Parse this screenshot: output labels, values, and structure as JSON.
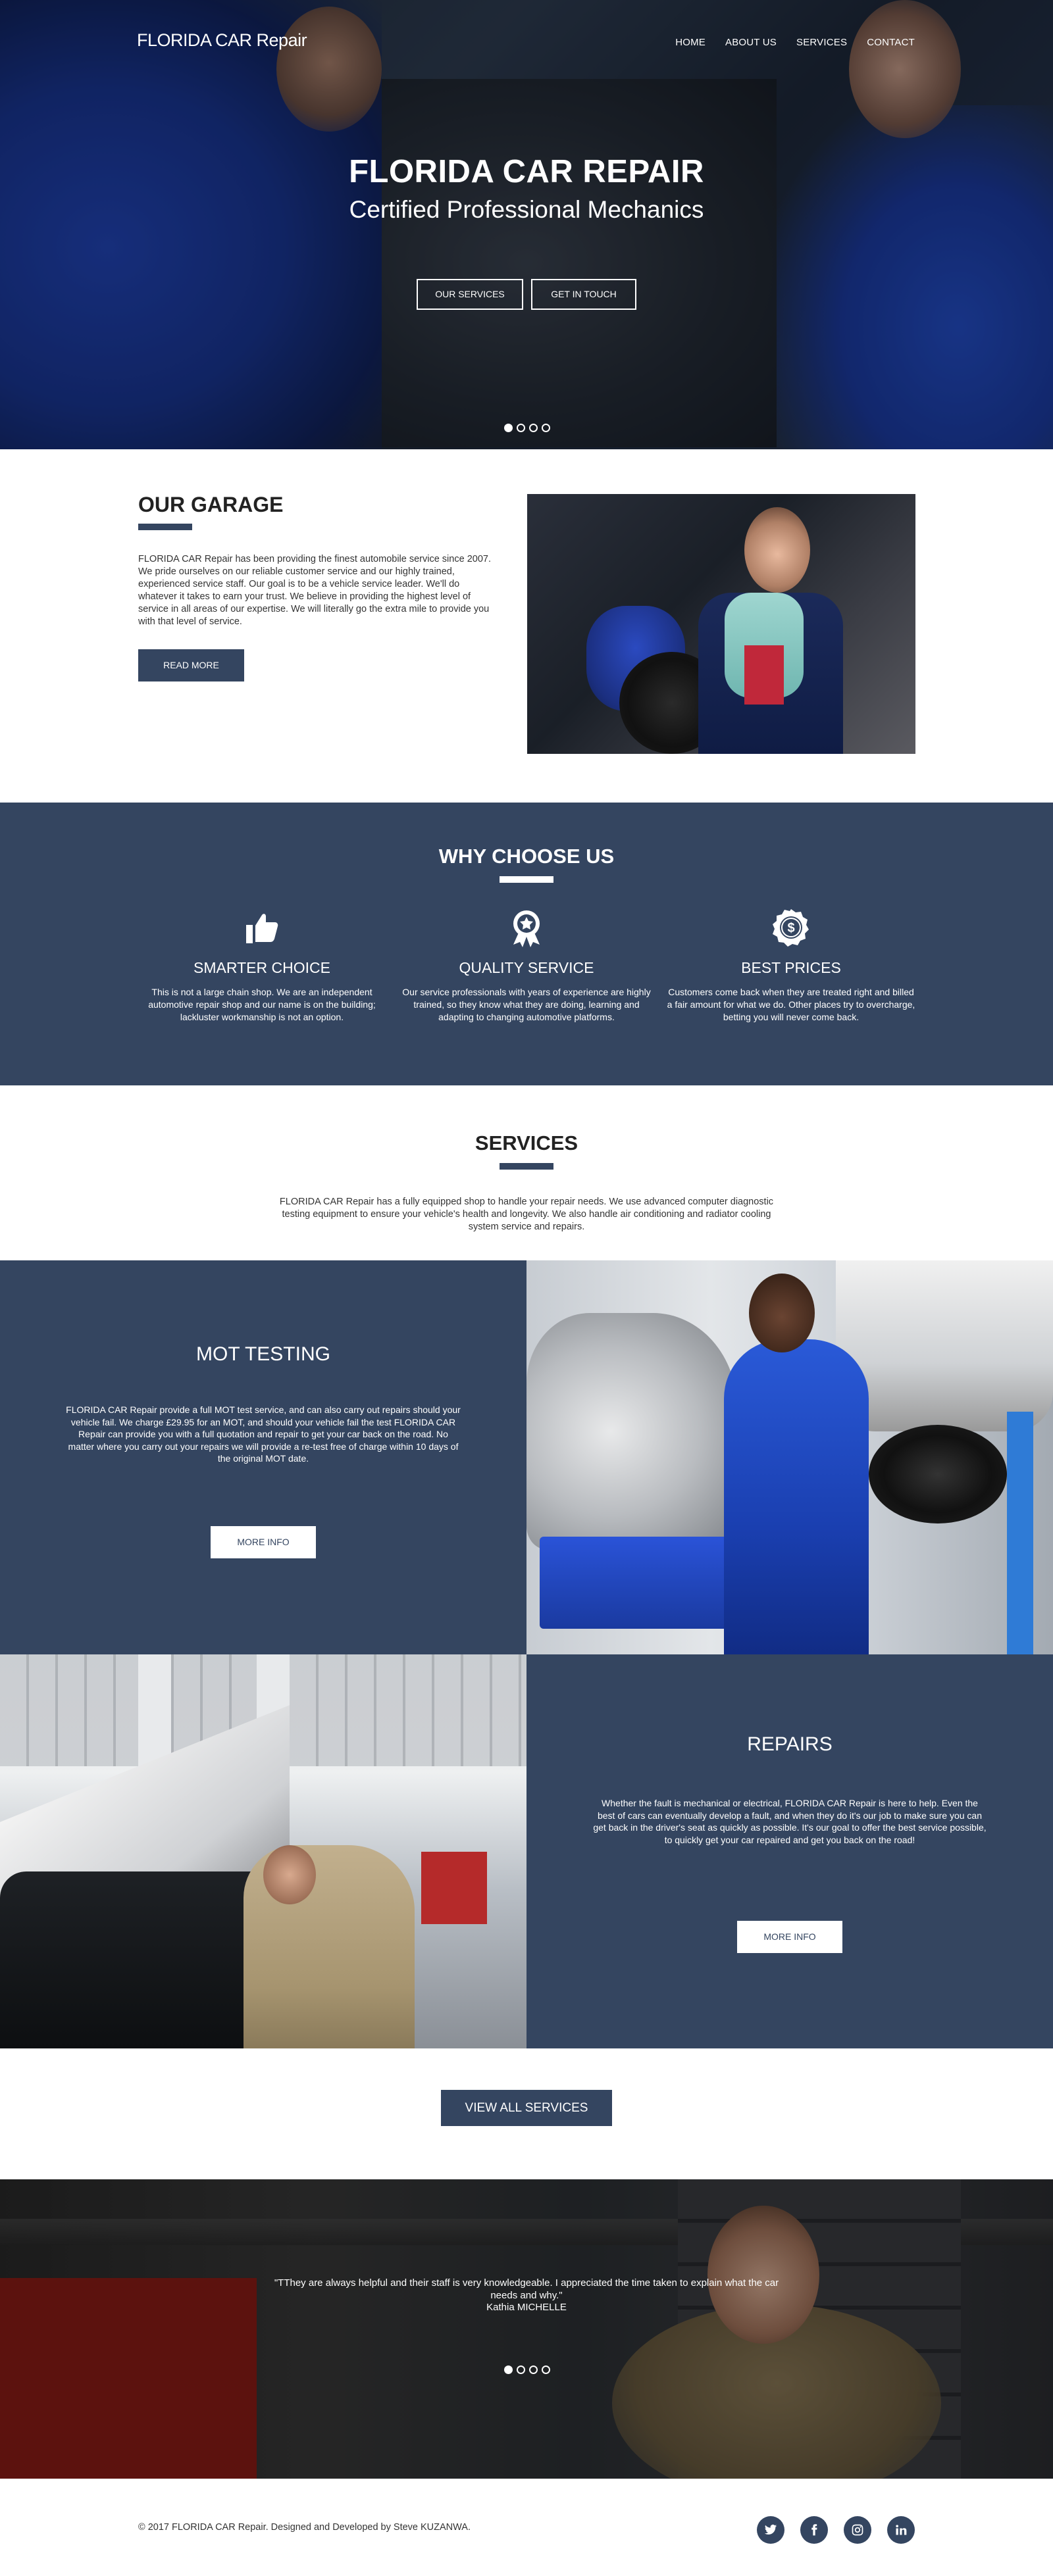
{
  "brand": "FLORIDA CAR Repair",
  "nav": [
    "HOME",
    "ABOUT US",
    "SERVICES",
    "CONTACT"
  ],
  "hero": {
    "title": "FLORIDA CAR REPAIR",
    "subtitle": "Certified Professional Mechanics",
    "btn_services": "OUR SERVICES",
    "btn_contact": "GET IN TOUCH"
  },
  "garage": {
    "title": "OUR GARAGE",
    "text": "FLORIDA CAR Repair has been providing the finest automobile service since 2007. We pride ourselves on our reliable customer service and our highly trained, experienced service staff. Our goal is to be a vehicle service leader. We'll do whatever it takes to earn your trust. We believe in providing the highest level of service in all areas of our expertise. We will literally go the extra mile to provide you with that level of service.",
    "button": "READ MORE"
  },
  "why": {
    "title": "WHY CHOOSE US",
    "features": [
      {
        "icon": "thumbs-up-icon",
        "title": "SMARTER CHOICE",
        "text": "This is not a large chain shop. We are an independent automotive repair shop and our name is on the building; lackluster workmanship is not an option."
      },
      {
        "icon": "award-ribbon-icon",
        "title": "QUALITY SERVICE",
        "text": "Our service professionals with years of experience are highly trained, so they know what they are doing, learning and adapting to changing automotive platforms."
      },
      {
        "icon": "dollar-badge-icon",
        "title": "BEST PRICES",
        "text": "Customers come back when they are treated right and billed a fair amount for what we do. Other places try to overcharge, betting you will never come back."
      }
    ]
  },
  "services": {
    "title": "SERVICES",
    "intro": "FLORIDA CAR Repair has a fully equipped shop to handle your repair needs. We use advanced computer diagnostic testing equipment to ensure your vehicle's health and longevity. We also handle air conditioning and radiator cooling system service and repairs.",
    "items": [
      {
        "title": "MOT TESTING",
        "text": "FLORIDA CAR Repair provide a full MOT test service, and can also carry out repairs should your vehicle fail. We charge £29.95 for an MOT, and should your vehicle fail the test FLORIDA CAR Repair can provide you with a full quotation and repair to get your car back on the road. No matter where you carry out your repairs we will provide a re-test free of charge within 10 days of the original MOT date.",
        "button": "MORE INFO"
      },
      {
        "title": "REPAIRS",
        "text": "Whether the fault is mechanical or electrical, FLORIDA CAR Repair is here to help. Even the best of cars can eventually develop a fault, and when they do it's our job to make sure you can get back in the driver's seat as quickly as possible. It's our goal to offer the best service possible, to quickly get your car repaired and get you back on the road!",
        "button": "MORE INFO"
      }
    ],
    "view_all": "VIEW ALL SERVICES"
  },
  "testimonial": {
    "quote": "\"TThey are always helpful and their staff is very knowledgeable. I appreciated the time taken to explain what the car needs and why.\"",
    "author": "Kathia MICHELLE"
  },
  "footer": {
    "copyright": "© 2017 FLORIDA CAR Repair. Designed and Developed by Steve KUZANWA.",
    "socials": [
      "twitter-icon",
      "facebook-icon",
      "instagram-icon",
      "linkedin-icon"
    ]
  },
  "colors": {
    "accent": "#344560",
    "white": "#ffffff"
  }
}
